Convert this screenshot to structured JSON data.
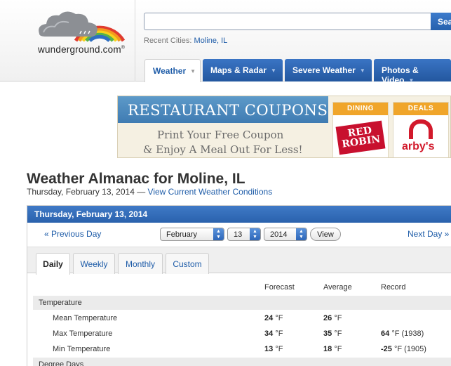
{
  "header": {
    "logo_text": "wunderground.com",
    "recent_label": "Recent Cities:",
    "recent_city": "Moline, IL",
    "search_button": "Sea",
    "search_placeholder": ""
  },
  "nav": [
    {
      "label": "Weather",
      "active": true
    },
    {
      "label": "Maps & Radar"
    },
    {
      "label": "Severe Weather"
    },
    {
      "label": "Photos & Video"
    }
  ],
  "ad": {
    "title": "RESTAURANT COUPONS",
    "line1": "Print Your Free Coupon",
    "line2": "& Enjoy A Meal Out For Less!",
    "cards": [
      {
        "head": "DINING",
        "brand_line1": "RED",
        "brand_line2": "ROBIN"
      },
      {
        "head": "DEALS",
        "brand": "arby's"
      }
    ]
  },
  "page": {
    "title": "Weather Almanac for Moline, IL",
    "date_text": "Thursday, February 13, 2014 —",
    "current_link": "View Current Weather Conditions"
  },
  "panel": {
    "header": "Thursday, February 13, 2014",
    "prev": "« Previous Day",
    "next": "Next Day »",
    "month": "February",
    "day": "13",
    "year": "2014",
    "view": "View",
    "tabs": [
      "Daily",
      "Weekly",
      "Monthly",
      "Custom"
    ],
    "columns": {
      "forecast": "Forecast",
      "average": "Average",
      "record": "Record"
    },
    "temperature_section": "Temperature",
    "degree_section": "Degree Days",
    "unit": "°F",
    "rows": [
      {
        "label": "Mean Temperature",
        "forecast": "24",
        "average": "26",
        "record": "",
        "record_year": ""
      },
      {
        "label": "Max Temperature",
        "forecast": "34",
        "average": "35",
        "record": "64",
        "record_year": "(1938)"
      },
      {
        "label": "Min Temperature",
        "forecast": "13",
        "average": "18",
        "record": "-25",
        "record_year": "(1905)"
      }
    ]
  },
  "colors": {
    "nav_blue": "#2a62ad",
    "link_blue": "#1e5ca8",
    "coupon_orange": "#f0a52a"
  }
}
